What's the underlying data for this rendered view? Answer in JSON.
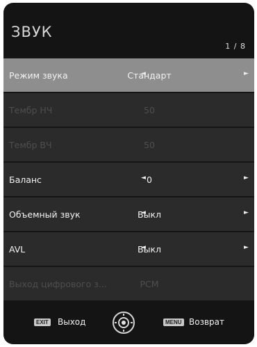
{
  "screen": {
    "title": "ЗВУК",
    "page_indicator": "1 / 8"
  },
  "menu_items": [
    {
      "label": "Режим звука",
      "value": "Стандарт",
      "state": "selected",
      "arrows": true
    },
    {
      "label": "Тембр НЧ",
      "value": "50",
      "state": "disabled",
      "arrows": false
    },
    {
      "label": "Тембр ВЧ",
      "value": "50",
      "state": "disabled",
      "arrows": false
    },
    {
      "label": "Баланс",
      "value": "0",
      "state": "normal",
      "arrows": true
    },
    {
      "label": "Объемный звук",
      "value": "Выкл",
      "state": "normal",
      "arrows": true
    },
    {
      "label": "AVL",
      "value": "Выкл",
      "state": "normal",
      "arrows": true
    },
    {
      "label": "Выход цифрового з...",
      "value": "PCM",
      "state": "disabled",
      "arrows": false
    }
  ],
  "arrows": {
    "left": "◄",
    "right": "►"
  },
  "footer": {
    "exit_key": "EXIT",
    "exit_label": "Выход",
    "menu_key": "MENU",
    "menu_label": "Возврат"
  },
  "colors": {
    "background": "#141414",
    "row": "#2b2b2b",
    "selected_row": "#8e8e8e",
    "disabled_text": "#4e4e4e",
    "text": "#f2f2f2"
  }
}
